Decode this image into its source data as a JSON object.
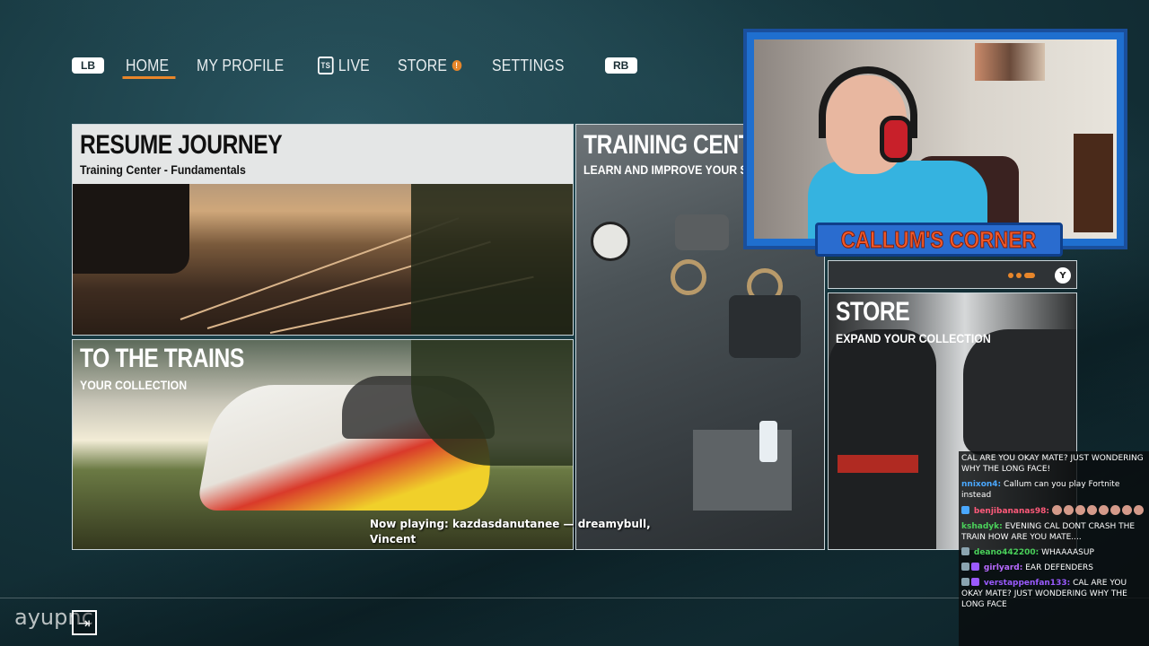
{
  "nav": {
    "left_button": "LB",
    "right_button": "RB",
    "items": [
      {
        "label": "HOME",
        "active": true
      },
      {
        "label": "MY PROFILE"
      },
      {
        "label": "LIVE",
        "icon": "live-icon",
        "icon_text": "TS"
      },
      {
        "label": "STORE",
        "icon": "alert-dot-icon",
        "badge": "!"
      },
      {
        "label": "SETTINGS"
      }
    ]
  },
  "tiles": {
    "resume": {
      "title": "RESUME JOURNEY",
      "subtitle": "Training Center - Fundamentals"
    },
    "trains": {
      "title": "TO THE TRAINS",
      "subtitle": "YOUR COLLECTION"
    },
    "training": {
      "title": "TRAINING CENTE",
      "subtitle": "LEARN AND IMPROVE YOUR S"
    },
    "store": {
      "title": "STORE",
      "subtitle": "EXPAND YOUR COLLECTION"
    },
    "smallbar": {
      "button": "Y"
    }
  },
  "webcam": {
    "banner": "CALLUM'S CORNER"
  },
  "now_playing": {
    "line1": "Now playing: kazdasdanutanee — dreamybull,",
    "line2": "Vincent"
  },
  "watermark": "ayupnc",
  "chat": [
    {
      "user": "",
      "text": "CAL ARE YOU OKAY MATE? JUST WONDERING WHY THE LONG FACE!",
      "color": "#9aa4ff"
    },
    {
      "user": "nnixon4:",
      "text": "Callum can you play Fortnite instead",
      "color": "#4aa8ff"
    },
    {
      "user": "benjibananas98:",
      "text": "",
      "emotes": 8,
      "color": "#ff5a7a"
    },
    {
      "user": "kshadyk:",
      "text": "EVENING CAL DONT CRASH THE TRAIN HOW ARE YOU MATE....",
      "color": "#4ad15a"
    },
    {
      "user": "deano442200:",
      "text": "WHAAAASUP",
      "color": "#4ad15a"
    },
    {
      "user": "girlyard:",
      "text": "EAR DEFENDERS",
      "color": "#b86aff"
    },
    {
      "user": "verstappenfan133:",
      "text": "CAL ARE YOU OKAY MATE? JUST WONDERING WHY THE LONG FACE",
      "color": "#9a5aff"
    }
  ],
  "colors": {
    "accent": "#e8862a",
    "banner_text": "#f05a2a",
    "webcam_frame": "#1f6fcf"
  }
}
